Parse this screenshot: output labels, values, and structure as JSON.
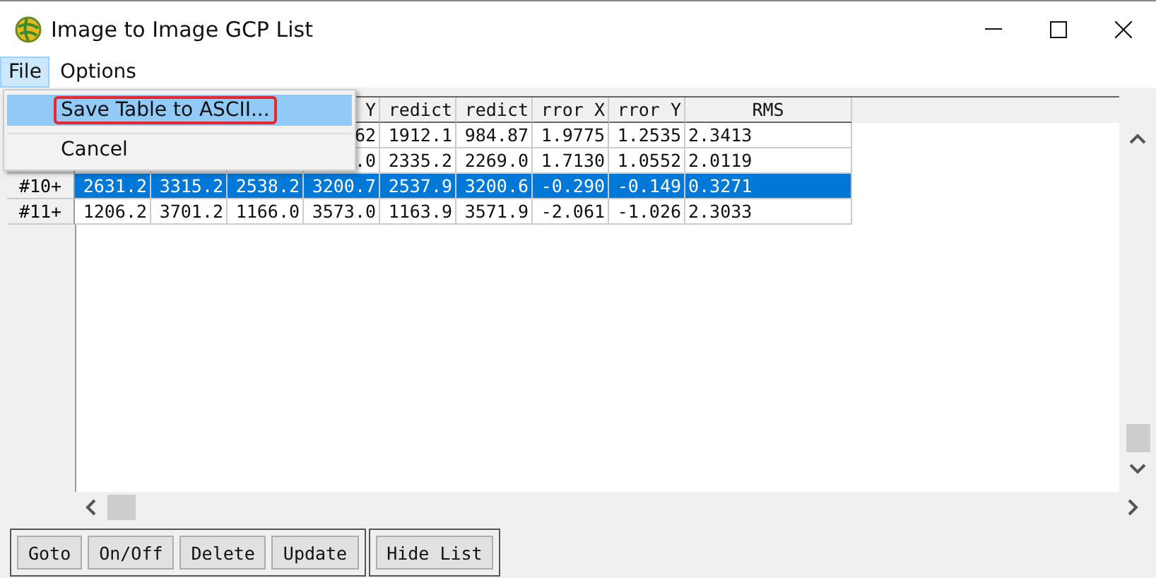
{
  "window": {
    "title": "Image to Image GCP List"
  },
  "menu_bar": [
    {
      "label": "File",
      "selected": true
    },
    {
      "label": "Options",
      "selected": false
    }
  ],
  "file_menu": {
    "items": [
      {
        "label": "Save Table to ASCII...",
        "selected": true,
        "annotated": true
      },
      {
        "label": "Cancel",
        "selected": false,
        "annotated": false
      }
    ]
  },
  "table": {
    "columns": [
      "",
      "",
      "",
      "Y",
      "redict",
      "redict",
      "rror X",
      "rror Y",
      "RMS"
    ],
    "rows": [
      {
        "label": null,
        "selected": false,
        "cells": [
          "",
          "",
          "",
          "62",
          "1912.1",
          "984.87",
          "1.9775",
          "1.2535",
          "2.3413"
        ]
      },
      {
        "label": null,
        "selected": false,
        "cells": [
          "",
          "",
          "",
          ".0",
          "2335.2",
          "2269.0",
          "1.7130",
          "1.0552",
          "2.0119"
        ]
      },
      {
        "label": "#10+",
        "selected": true,
        "cells": [
          "2631.2",
          "3315.2",
          "2538.2",
          "3200.7",
          "2537.9",
          "3200.6",
          "-0.290",
          "-0.149",
          "0.3271"
        ]
      },
      {
        "label": "#11+",
        "selected": false,
        "cells": [
          "1206.2",
          "3701.2",
          "1166.0",
          "3573.0",
          "1163.9",
          "3571.9",
          "-2.061",
          "-1.026",
          "2.3033"
        ]
      }
    ]
  },
  "button_groups": [
    [
      "Goto",
      "On/Off",
      "Delete",
      "Update"
    ],
    [
      "Hide List"
    ]
  ]
}
